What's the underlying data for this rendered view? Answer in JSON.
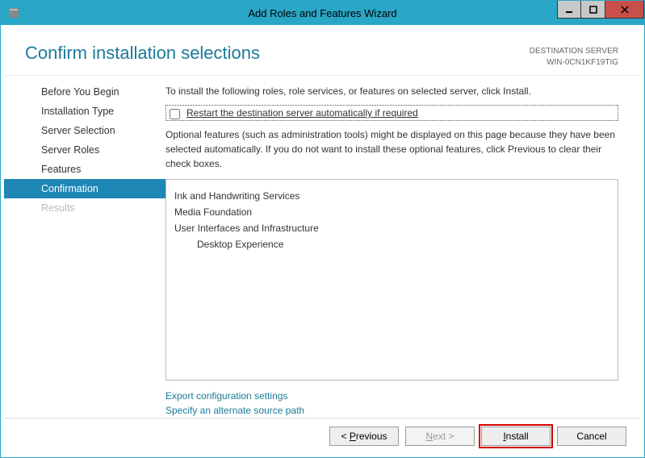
{
  "window": {
    "title": "Add Roles and Features Wizard"
  },
  "header": {
    "page_title": "Confirm installation selections",
    "dest_label": "DESTINATION SERVER",
    "dest_server": "WIN-0CN1KF19TIG"
  },
  "sidebar": {
    "items": [
      {
        "label": "Before You Begin",
        "state": "normal"
      },
      {
        "label": "Installation Type",
        "state": "normal"
      },
      {
        "label": "Server Selection",
        "state": "normal"
      },
      {
        "label": "Server Roles",
        "state": "normal"
      },
      {
        "label": "Features",
        "state": "normal"
      },
      {
        "label": "Confirmation",
        "state": "active"
      },
      {
        "label": "Results",
        "state": "disabled"
      }
    ]
  },
  "main": {
    "intro": "To install the following roles, role services, or features on selected server, click Install.",
    "restart_label": "Restart the destination server automatically if required",
    "restart_checked": false,
    "optional_text": "Optional features (such as administration tools) might be displayed on this page because they have been selected automatically. If you do not want to install these optional features, click Previous to clear their check boxes.",
    "features": [
      {
        "label": "Ink and Handwriting Services",
        "level": 1
      },
      {
        "label": "Media Foundation",
        "level": 1
      },
      {
        "label": "User Interfaces and Infrastructure",
        "level": 1
      },
      {
        "label": "Desktop Experience",
        "level": 2
      }
    ],
    "links": {
      "export": "Export configuration settings",
      "source": "Specify an alternate source path"
    }
  },
  "footer": {
    "previous_prefix": "< ",
    "previous_u": "P",
    "previous_rest": "revious",
    "next_u": "N",
    "next_rest": "ext >",
    "install_u": "I",
    "install_rest": "nstall",
    "cancel": "Cancel"
  }
}
